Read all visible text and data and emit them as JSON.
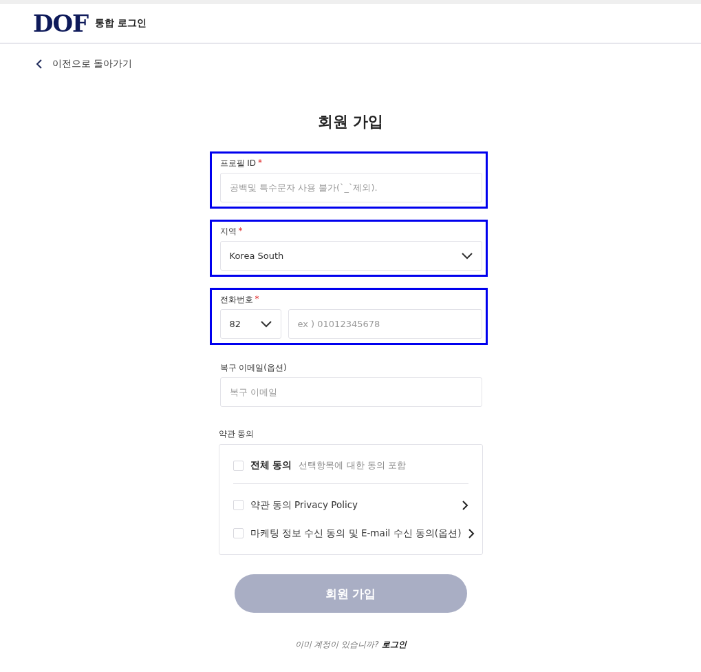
{
  "header": {
    "logo": "DOF",
    "title": "통합 로그인"
  },
  "back_link": "이전으로 돌아가기",
  "page_title": "회원 가입",
  "fields": [
    {
      "kind": "text",
      "label": "프로필 ID",
      "required_mark": "*",
      "highlighted": true,
      "placeholder": "공백및 특수문자 사용 불가(`_`제외)."
    },
    {
      "kind": "select",
      "label": "지역",
      "required_mark": "*",
      "highlighted": true,
      "value": "Korea South"
    },
    {
      "kind": "phone",
      "label": "전화번호",
      "required_mark": "*",
      "highlighted": true,
      "code": "82",
      "placeholder": "ex ) 01012345678"
    },
    {
      "kind": "text",
      "label": "복구 이메일(옵션)",
      "highlighted": false,
      "placeholder": "복구 이메일"
    }
  ],
  "terms": {
    "label": "약관 동의",
    "all": {
      "checked": false,
      "title": "전체 동의",
      "note": "선택항목에 대한 동의 포함"
    },
    "items": [
      {
        "checked": false,
        "text": "약관 동의 Privacy Policy",
        "has_arrow": true
      },
      {
        "checked": false,
        "text": "마케팅 정보 수신 동의 및 E-mail 수신 동의(옵션)",
        "has_arrow": true
      }
    ]
  },
  "submit": {
    "label": "회원 가입",
    "disabled": true
  },
  "footer": {
    "prompt": "이미 계정이 있습니까?",
    "link": "로그인"
  }
}
